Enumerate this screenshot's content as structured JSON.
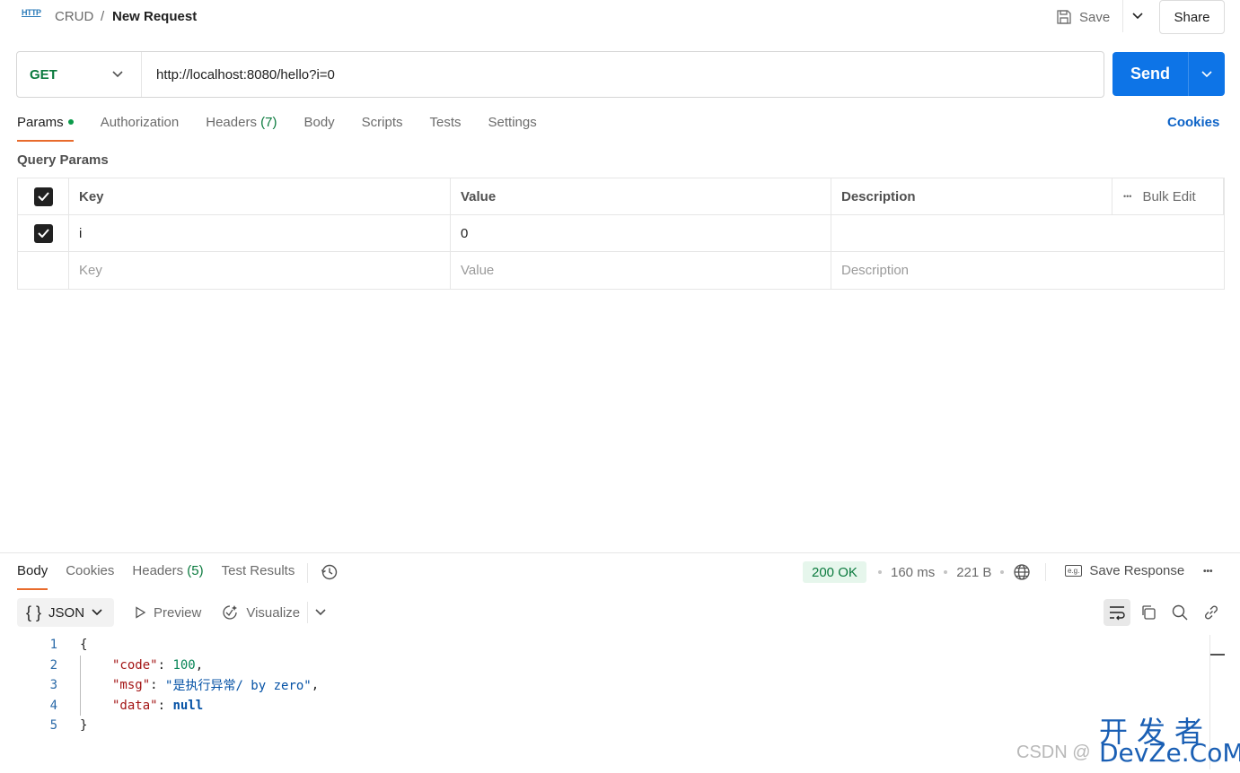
{
  "header": {
    "icon_text": "HTTP",
    "collection": "CRUD",
    "separator": "/",
    "title": "New Request",
    "save_label": "Save",
    "share_label": "Share"
  },
  "request": {
    "method": "GET",
    "url": "http://localhost:8080/hello?i=0",
    "send_label": "Send"
  },
  "request_tabs": [
    {
      "label": "Params",
      "count": "",
      "active": true,
      "dot": true
    },
    {
      "label": "Authorization",
      "count": ""
    },
    {
      "label": "Headers",
      "count": "(7)"
    },
    {
      "label": "Body",
      "count": ""
    },
    {
      "label": "Scripts",
      "count": ""
    },
    {
      "label": "Tests",
      "count": ""
    },
    {
      "label": "Settings",
      "count": ""
    }
  ],
  "cookies_link": "Cookies",
  "query_params": {
    "title": "Query Params",
    "headers": {
      "key": "Key",
      "value": "Value",
      "description": "Description",
      "bulk_edit": "Bulk Edit",
      "more": "•••"
    },
    "rows": [
      {
        "key": "i",
        "value": "0",
        "description": "",
        "checked": true
      }
    ],
    "placeholders": {
      "key": "Key",
      "value": "Value",
      "description": "Description"
    }
  },
  "response": {
    "tabs": [
      {
        "label": "Body",
        "count": "",
        "active": true
      },
      {
        "label": "Cookies",
        "count": ""
      },
      {
        "label": "Headers",
        "count": "(5)"
      },
      {
        "label": "Test Results",
        "count": ""
      }
    ],
    "status": "200 OK",
    "time": "160 ms",
    "size": "221 B",
    "save_response": "Save Response",
    "save_response_icon": "e.g.",
    "more": "•••",
    "format": "JSON",
    "format_icon": "{ }",
    "preview": "Preview",
    "visualize": "Visualize",
    "line_numbers": [
      "1",
      "2",
      "3",
      "4",
      "5"
    ],
    "json": {
      "open": "{",
      "close": "}",
      "code_key": "\"code\"",
      "code_val": "100",
      "msg_key": "\"msg\"",
      "msg_val": "\"是执行异常/ by zero\"",
      "data_key": "\"data\"",
      "data_val": "null",
      "colon": ": ",
      "comma": ","
    }
  },
  "watermark": {
    "cn": "开发者",
    "csdn": "CSDN @",
    "dev": "DevZe.CoM"
  },
  "colors": {
    "accent_orange": "#e86b2c",
    "send_blue": "#0d74e7",
    "get_green": "#0b7a3e",
    "status_bg": "#e6f6ec"
  }
}
